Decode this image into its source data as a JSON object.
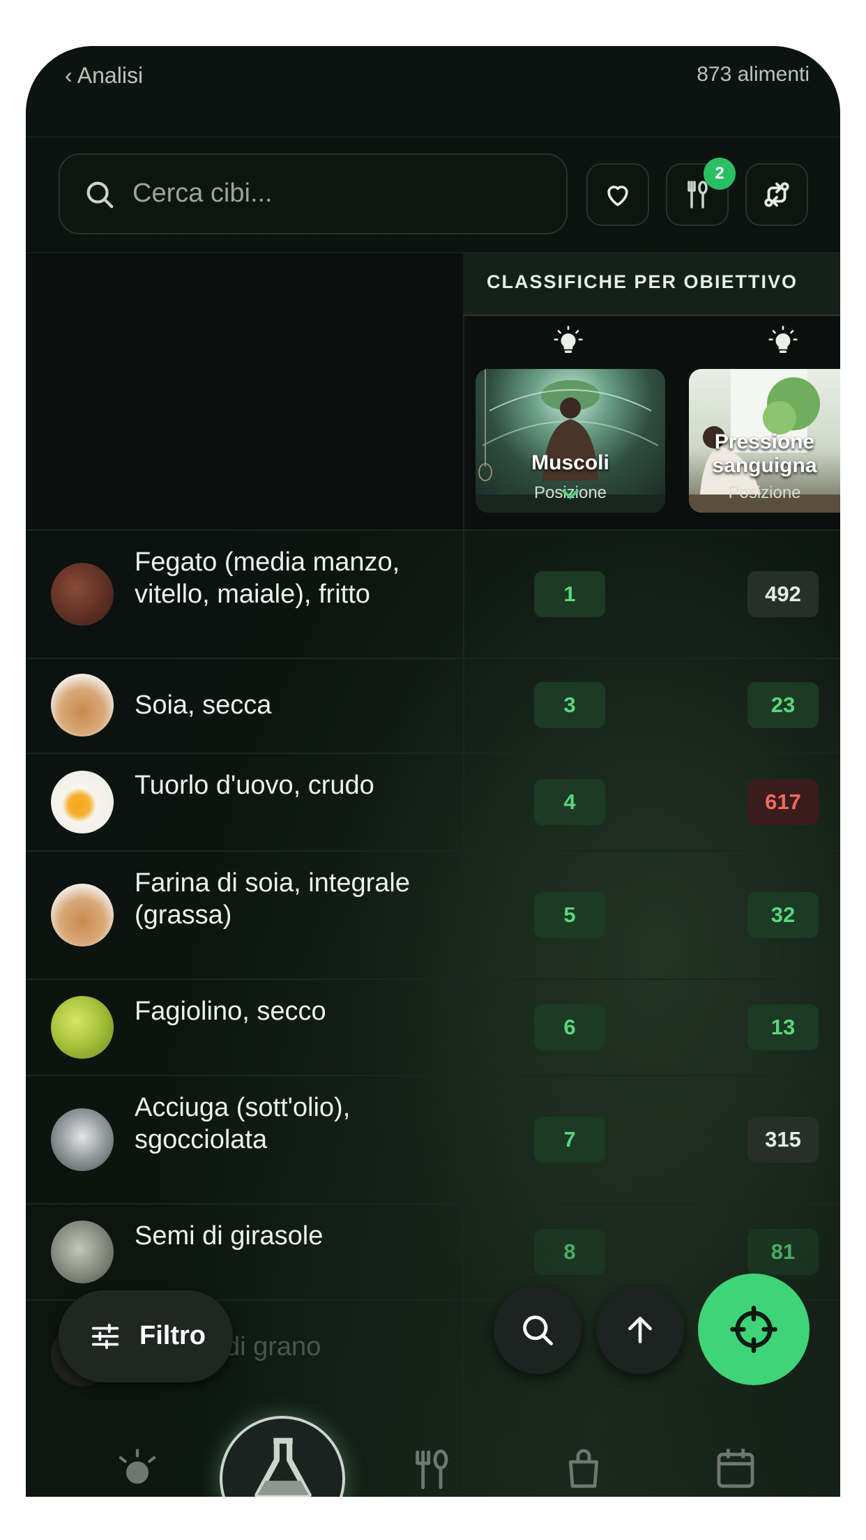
{
  "header": {
    "back_label": "‹ Analisi",
    "food_count": "873 alimenti"
  },
  "search": {
    "placeholder": "Cerca cibi..."
  },
  "toolbar": {
    "favorites_icon": "heart-icon",
    "meals_icon": "fork-spoon-icon",
    "meals_badge": "2",
    "compare_icon": "swap-icon"
  },
  "goals": {
    "section_title": "CLASSIFICHE PER OBIETTIVO",
    "columns": [
      {
        "title": "Muscoli",
        "subtitle": "Posizione"
      },
      {
        "title": "Pressione sanguigna",
        "subtitle": "Posizione"
      }
    ]
  },
  "foods": [
    {
      "name": "Fegato (media manzo, vitello, maiale), fritto",
      "muscles_rank": "1",
      "bp_rank": "492",
      "bp_status": "neutral"
    },
    {
      "name": "Soia, secca",
      "muscles_rank": "3",
      "bp_rank": "23",
      "bp_status": "good"
    },
    {
      "name": "Tuorlo d'uovo, crudo",
      "muscles_rank": "4",
      "bp_rank": "617",
      "bp_status": "bad"
    },
    {
      "name": "Farina di soia, integrale (grassa)",
      "muscles_rank": "5",
      "bp_rank": "32",
      "bp_status": "good"
    },
    {
      "name": "Fagiolino, secco",
      "muscles_rank": "6",
      "bp_rank": "13",
      "bp_status": "good"
    },
    {
      "name": "Acciuga (sott'olio), sgocciolata",
      "muscles_rank": "7",
      "bp_rank": "315",
      "bp_status": "neutral"
    },
    {
      "name": "Semi di girasole",
      "muscles_rank": "8",
      "bp_rank": "81",
      "bp_status": "good"
    },
    {
      "name": "di grano"
    }
  ],
  "actions": {
    "filter_label": "Filtro"
  },
  "colors": {
    "good": "#5bd67d",
    "bad": "#ef6b62",
    "accent": "#3ed477"
  }
}
